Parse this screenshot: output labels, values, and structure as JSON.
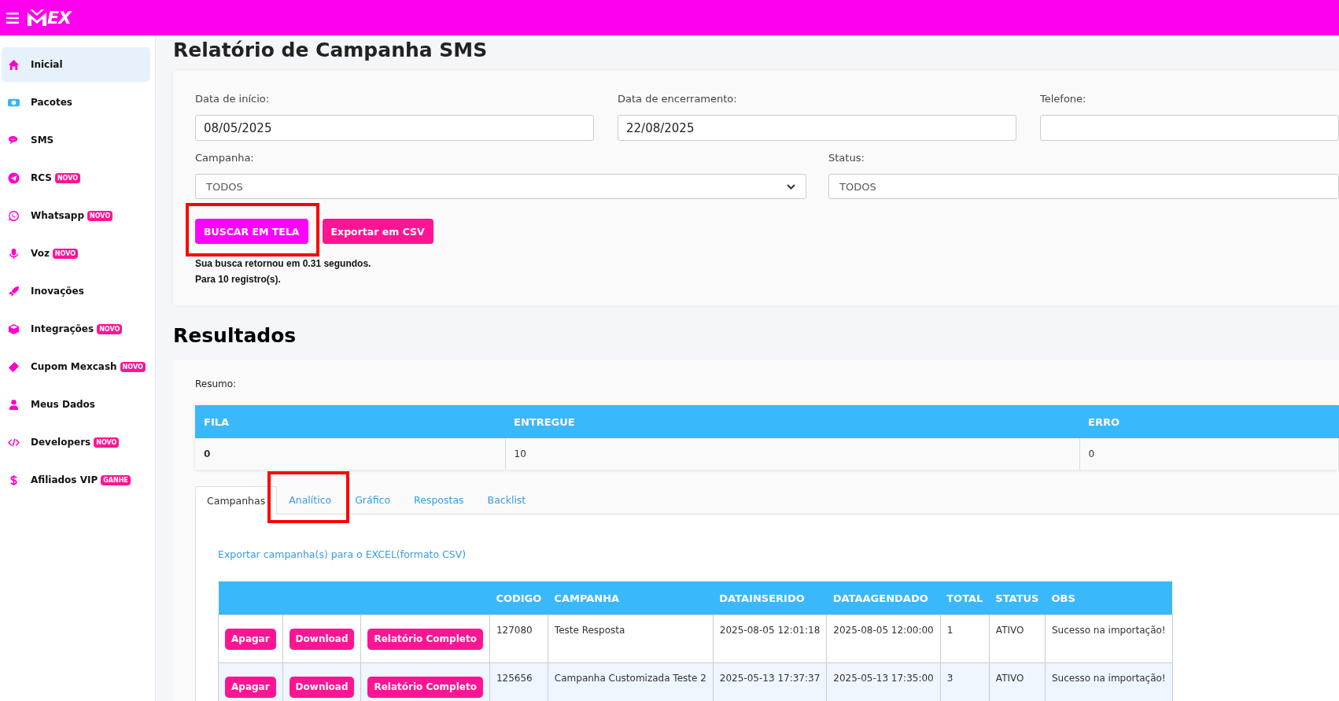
{
  "header": {
    "logo_text": "EX"
  },
  "sidebar": {
    "items": [
      {
        "label": "Inicial",
        "selected": true
      },
      {
        "label": "Pacotes",
        "selected": false
      },
      {
        "label": "SMS",
        "selected": false
      },
      {
        "label": "RCS",
        "selected": false,
        "badge": "NOVO"
      },
      {
        "label": "Whatsapp",
        "selected": false,
        "badge": "NOVO"
      },
      {
        "label": "Voz",
        "selected": false,
        "badge": "NOVO"
      },
      {
        "label": "Inovações",
        "selected": false
      },
      {
        "label": "Integrações",
        "selected": false,
        "badge": "NOVO"
      },
      {
        "label": "Cupom Mexcash",
        "selected": false,
        "badge": "NOVO"
      },
      {
        "label": "Meus Dados",
        "selected": false
      },
      {
        "label": "Developers",
        "selected": false,
        "badge": "NOVO"
      },
      {
        "label": "Afiliados VIP",
        "selected": false,
        "badge": "GANHE"
      }
    ]
  },
  "page_title": "Relatório de Campanha SMS",
  "filters": {
    "fields": [
      {
        "label": "Data de início:",
        "value": "08/05/2025",
        "kind": "text"
      },
      {
        "label": "Data de encerramento:",
        "value": "22/08/2025",
        "kind": "text"
      },
      {
        "label": "Telefone:",
        "kind": "text"
      }
    ],
    "selects": [
      {
        "label": "Campanha:",
        "value": "TODOS",
        "kind": "dropdown"
      },
      {
        "label": "Status:",
        "value": "TODOS",
        "kind": "plain"
      }
    ],
    "buttons": [
      {
        "label": "BUSCAR EM TELA",
        "kind": "primary",
        "highlighted": true
      },
      {
        "label": "Exportar em CSV",
        "kind": "secondary",
        "highlighted": false
      }
    ],
    "messages": [
      "Sua busca retornou em 0.31 segundos.",
      "Para 10 registro(s)."
    ]
  },
  "results_title": "Resultados",
  "summary": {
    "label": "Resumo:",
    "columns": [
      "FILA",
      "ENTREGUE",
      "ERRO"
    ],
    "values": [
      "0",
      "10",
      "0"
    ]
  },
  "tabs": [
    {
      "label": "Campanhas",
      "selected": true,
      "highlighted": false
    },
    {
      "label": "Analítico",
      "selected": false,
      "highlighted": true
    },
    {
      "label": "Gráfico",
      "selected": false,
      "highlighted": false
    },
    {
      "label": "Respostas",
      "selected": false,
      "highlighted": false
    },
    {
      "label": "Backlist",
      "selected": false,
      "highlighted": false
    }
  ],
  "export_link": "Exportar campanha(s) para o EXCEL(formato CSV)",
  "table": {
    "columns": [
      "CODIGO",
      "CAMPANHA",
      "DATAINSERIDO",
      "DATAAGENDADO",
      "TOTAL",
      "STATUS",
      "OBS"
    ],
    "rows": [
      {
        "actions": [
          "Apagar",
          "Download",
          "Relatório Completo"
        ],
        "cells": [
          "127080",
          "Teste Resposta",
          "2025-08-05 12:01:18",
          "2025-08-05 12:00:00",
          "1",
          "ATIVO",
          "Sucesso na importação!"
        ]
      },
      {
        "actions": [
          "Apagar",
          "Download",
          "Relatório Completo"
        ],
        "cells": [
          "125656",
          "Campanha Customizada Teste 2",
          "2025-05-13 17:37:37",
          "2025-05-13 17:35:00",
          "3",
          "ATIVO",
          "Sucesso na importação!"
        ]
      }
    ]
  }
}
